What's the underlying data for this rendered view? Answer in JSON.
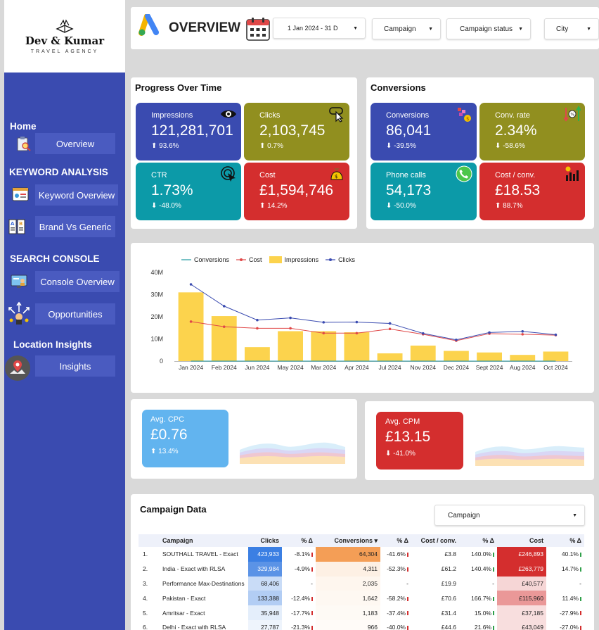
{
  "brand": {
    "name": "Dev & Kumar",
    "tagline": "TRAVEL AGENCY"
  },
  "sidebar": {
    "sections": [
      {
        "title": "Home"
      },
      {
        "title": "KEYWORD ANALYSIS"
      },
      {
        "title": "SEARCH CONSOLE"
      },
      {
        "title": "Location Insights"
      }
    ],
    "items": [
      {
        "label": "Overview",
        "icon": "clipboard-search-icon"
      },
      {
        "label": "Keyword Overview",
        "icon": "keyword-card-icon"
      },
      {
        "label": "Brand Vs Generic",
        "icon": "ab-compare-icon"
      },
      {
        "label": "Console Overview",
        "icon": "console-person-icon"
      },
      {
        "label": "Opportunities",
        "icon": "opportunity-arrows-icon"
      },
      {
        "label": "Insights",
        "icon": "map-pin-icon"
      }
    ]
  },
  "header": {
    "title": "OVERVIEW",
    "date_range": "1 Jan 2024 - 31 D",
    "filters": [
      "Campaign",
      "Campaign status",
      "City"
    ]
  },
  "progress": {
    "title": "Progress Over Time",
    "kpis": [
      {
        "label": "Impressions",
        "value": "121,281,701",
        "change": "93.6%",
        "dir": "up",
        "icon": "eye-icon"
      },
      {
        "label": "Clicks",
        "value": "2,103,745",
        "change": "0.7%",
        "dir": "up",
        "icon": "click-cursor-icon"
      },
      {
        "label": "CTR",
        "value": "1.73%",
        "change": "-48.0%",
        "dir": "down",
        "icon": "target-click-icon"
      },
      {
        "label": "Cost",
        "value": "£1,594,746",
        "change": "14.2%",
        "dir": "up",
        "icon": "money-bag-icon"
      }
    ]
  },
  "conversions": {
    "title": "Conversions",
    "kpis": [
      {
        "label": "Conversions",
        "value": "86,041",
        "change": "-39.5%",
        "dir": "down",
        "icon": "funnel-coin-icon"
      },
      {
        "label": "Conv. rate",
        "value": "2.34%",
        "change": "-58.6%",
        "dir": "down",
        "icon": "percent-arrows-icon"
      },
      {
        "label": "Phone calls",
        "value": "54,173",
        "change": "-50.0%",
        "dir": "down",
        "icon": "phone-icon"
      },
      {
        "label": "Cost / conv.",
        "value": "£18.53",
        "change": "88.7%",
        "dir": "up",
        "icon": "cost-chart-icon"
      }
    ]
  },
  "chart_data": {
    "type": "bar",
    "categories": [
      "Jan 2024",
      "Feb 2024",
      "Jun 2024",
      "May 2024",
      "Mar 2024",
      "Apr 2024",
      "Jul 2024",
      "Nov 2024",
      "Dec 2024",
      "Sept 2024",
      "Aug 2024",
      "Oct 2024"
    ],
    "ylim": [
      0,
      40000000
    ],
    "yticks": [
      "0",
      "10M",
      "20M",
      "30M",
      "40M"
    ],
    "grid": false,
    "legend_position": "top",
    "series": [
      {
        "name": "Conversions",
        "type": "line",
        "color": "#1e9aa0",
        "values": [
          7000,
          6800,
          6500,
          6400,
          6300,
          6200,
          5800,
          5000,
          4200,
          4000,
          3900,
          3700
        ]
      },
      {
        "name": "Cost",
        "type": "line",
        "color": "#e04848",
        "values": [
          17800000,
          15500000,
          14800000,
          14800000,
          12600000,
          12600000,
          14500000,
          12100000,
          9200000,
          12400000,
          12100000,
          11700000
        ]
      },
      {
        "name": "Impressions",
        "type": "bar",
        "color": "#fcd34d",
        "values": [
          31000000,
          20300000,
          6300000,
          13500000,
          13500000,
          13000000,
          3500000,
          7000000,
          4600000,
          3900000,
          2800000,
          4300000
        ]
      },
      {
        "name": "Clicks",
        "type": "line",
        "color": "#3a4bb0",
        "values": [
          34600000,
          24800000,
          18500000,
          19500000,
          17500000,
          17600000,
          17000000,
          12500000,
          9600000,
          12900000,
          13400000,
          11900000
        ]
      }
    ]
  },
  "avg_cpc": {
    "label": "Avg. CPC",
    "value": "£0.76",
    "change": "13.4%",
    "dir": "up"
  },
  "avg_cpm": {
    "label": "Avg. CPM",
    "value": "£13.15",
    "change": "-41.0%",
    "dir": "down"
  },
  "campaign": {
    "title": "Campaign Data",
    "filter": "Campaign",
    "columns": [
      "Campaign",
      "Clicks",
      "% Δ",
      "Conversions ▾",
      "% Δ",
      "Cost / conv.",
      "% Δ",
      "Cost",
      "% Δ"
    ],
    "rows": [
      {
        "n": "1.",
        "name": "SOUTHALL TRAVEL - Exact",
        "clicks": "423,933",
        "c_d": "-8.1%",
        "conv": "64,304",
        "cv_d": "-41.6%",
        "cpc": "£3.8",
        "cpc_d": "140.0%",
        "cost": "£246,893",
        "cost_d": "40.1%"
      },
      {
        "n": "2.",
        "name": "India - Exact with RLSA",
        "clicks": "329,984",
        "c_d": "-4.9%",
        "conv": "4,311",
        "cv_d": "-52.3%",
        "cpc": "£61.2",
        "cpc_d": "140.4%",
        "cost": "£263,779",
        "cost_d": "14.7%"
      },
      {
        "n": "3.",
        "name": "Performance Max-Destinations",
        "clicks": "68,406",
        "c_d": "-",
        "conv": "2,035",
        "cv_d": "-",
        "cpc": "£19.9",
        "cpc_d": "-",
        "cost": "£40,577",
        "cost_d": "-"
      },
      {
        "n": "4.",
        "name": "Pakistan - Exact",
        "clicks": "133,388",
        "c_d": "-12.4%",
        "conv": "1,642",
        "cv_d": "-58.2%",
        "cpc": "£70.6",
        "cpc_d": "166.7%",
        "cost": "£115,960",
        "cost_d": "11.4%"
      },
      {
        "n": "5.",
        "name": "Amritsar - Exact",
        "clicks": "35,948",
        "c_d": "-17.7%",
        "conv": "1,183",
        "cv_d": "-37.4%",
        "cpc": "£31.4",
        "cpc_d": "15.0%",
        "cost": "£37,185",
        "cost_d": "-27.9%"
      },
      {
        "n": "6.",
        "name": "Delhi - Exact with RLSA",
        "clicks": "27,787",
        "c_d": "-21.3%",
        "conv": "966",
        "cv_d": "-40.0%",
        "cpc": "£44.6",
        "cpc_d": "21.6%",
        "cost": "£43,049",
        "cost_d": "-27.0%"
      }
    ]
  }
}
